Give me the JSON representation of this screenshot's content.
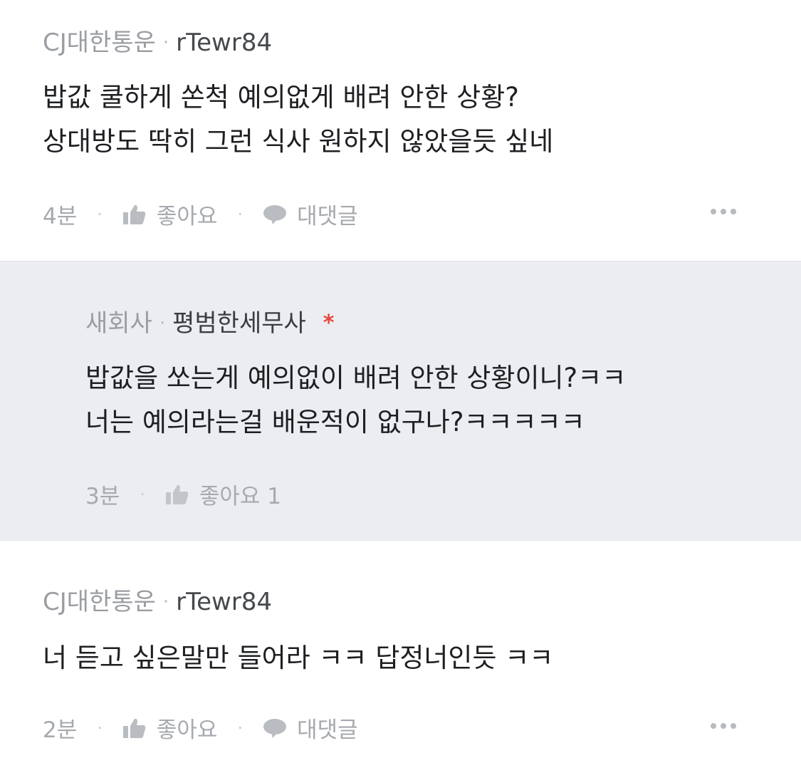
{
  "comments": [
    {
      "company": "CJ대한통운",
      "separator": "·",
      "author": "rTewr84",
      "lines": [
        "밥값 쿨하게 쏜척 예의없게 배려 안한 상황?",
        "상대방도 딱히 그런 식사 원하지 않았을듯 싶네"
      ],
      "time": "4분",
      "like_label": "좋아요",
      "reply_label": "대댓글"
    },
    {
      "company": "새회사",
      "separator": "·",
      "author": "평범한세무사",
      "badge": "*",
      "lines": [
        "밥값을 쏘는게 예의없이 배려 안한 상황이니?ㅋㅋ",
        "너는 예의라는걸 배운적이 없구나?ㅋㅋㅋㅋㅋ"
      ],
      "time": "3분",
      "like_label": "좋아요 1"
    },
    {
      "company": "CJ대한통운",
      "separator": "·",
      "author": "rTewr84",
      "lines": [
        "너 듣고 싶은말만 들어라 ㅋㅋ 답정너인듯 ㅋㅋ"
      ],
      "time": "2분",
      "like_label": "좋아요",
      "reply_label": "대댓글"
    }
  ],
  "colors": {
    "reply_background": "#ebedf0",
    "badge": "#e8453c",
    "meta": "#a6a9ae"
  }
}
